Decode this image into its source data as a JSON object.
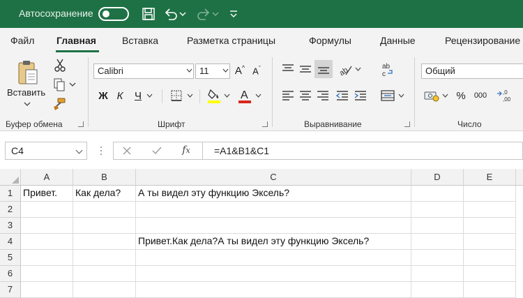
{
  "titlebar": {
    "autosave_label": "Автосохранение"
  },
  "tabs": [
    {
      "label": "Файл"
    },
    {
      "label": "Главная"
    },
    {
      "label": "Вставка"
    },
    {
      "label": "Разметка страницы"
    },
    {
      "label": "Формулы"
    },
    {
      "label": "Данные"
    },
    {
      "label": "Рецензирование"
    }
  ],
  "ribbon": {
    "clipboard": {
      "paste_label": "Вставить",
      "group_label": "Буфер обмена"
    },
    "font": {
      "font_name": "Calibri",
      "font_size": "11",
      "bold": "Ж",
      "italic": "К",
      "underline": "Ч",
      "group_label": "Шрифт"
    },
    "alignment": {
      "group_label": "Выравнивание"
    },
    "number": {
      "format": "Общий",
      "group_label": "Число"
    }
  },
  "formula_bar": {
    "name_box": "C4",
    "formula": "=A1&B1&C1"
  },
  "sheet": {
    "columns": [
      "A",
      "B",
      "C",
      "D",
      "E"
    ],
    "rows": [
      "1",
      "2",
      "3",
      "4",
      "5",
      "6",
      "7"
    ],
    "cells": {
      "A1": "Привет.",
      "B1": "Как дела?",
      "C1": "А ты видел эту функцию Эксель?",
      "C4": "Привет.Как  дела?А ты видел эту функцию Эксель?"
    }
  },
  "colors": {
    "accent": "#1e7145",
    "ribbon_bg": "#f3f3f3"
  }
}
